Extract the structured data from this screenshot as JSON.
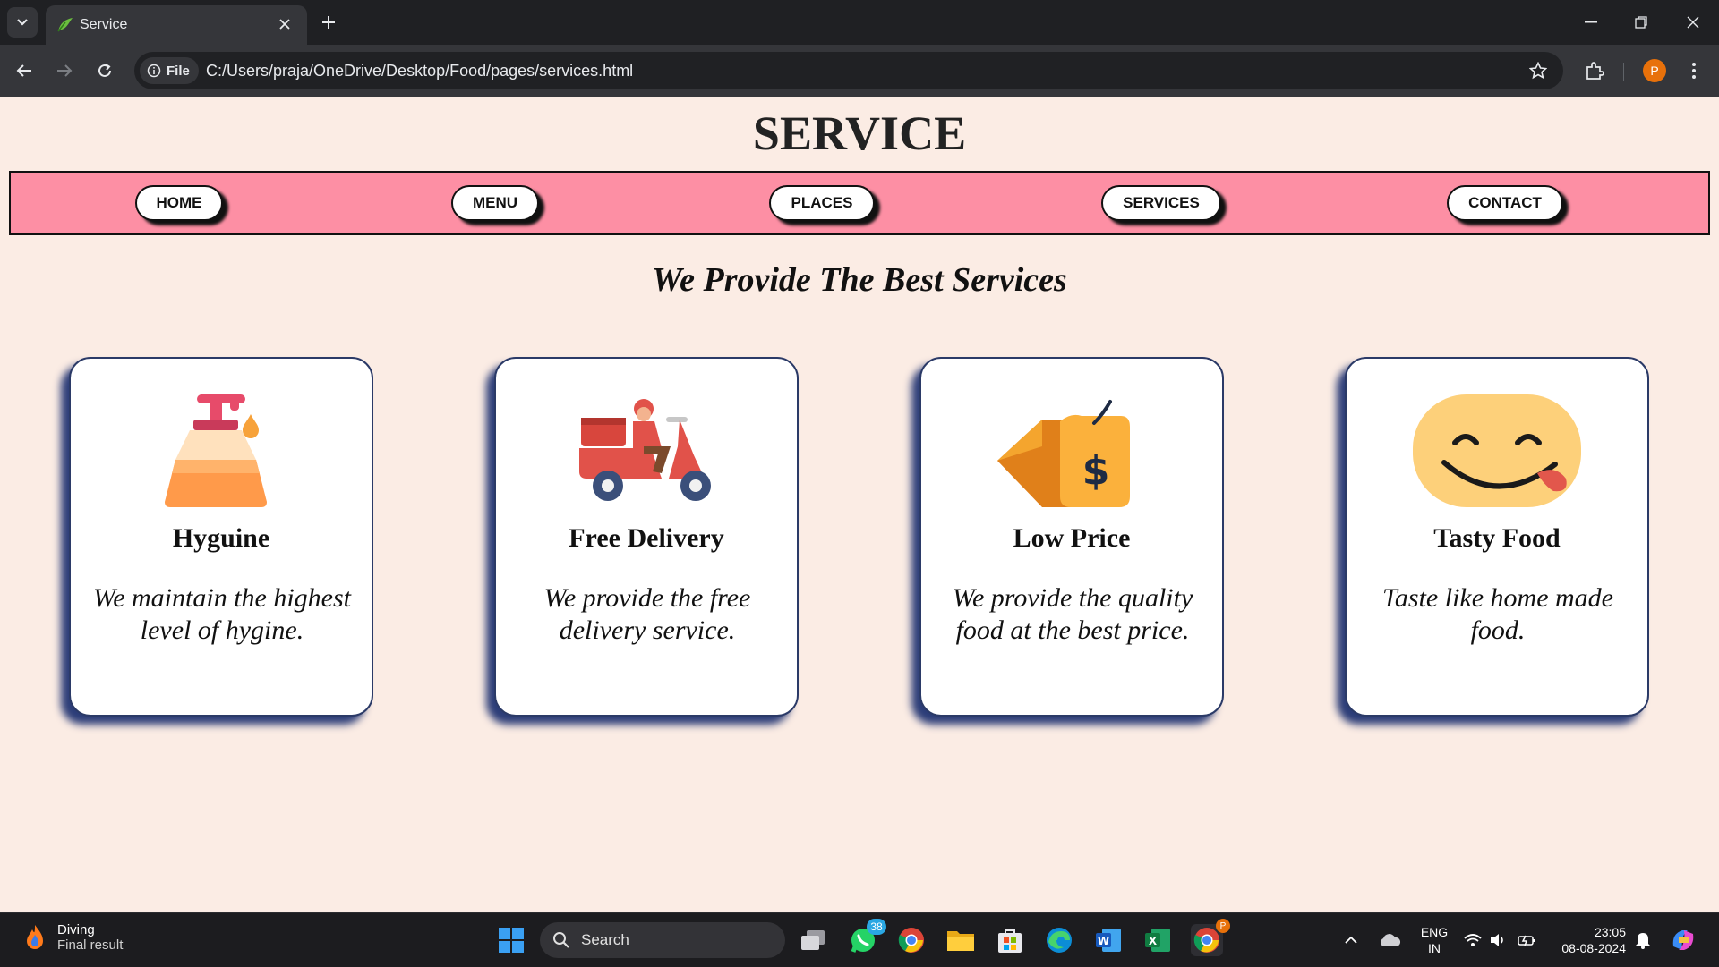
{
  "browser": {
    "tab_title": "Service",
    "address_chip": "File",
    "url": "C:/Users/praja/OneDrive/Desktop/Food/pages/services.html",
    "profile_initial": "P"
  },
  "page": {
    "title": "SERVICE",
    "nav": [
      "HOME",
      "MENU",
      "PLACES",
      "SERVICES",
      "CONTACT"
    ],
    "subtitle": "We Provide The Best Services",
    "cards": [
      {
        "icon": "soap-dispenser-icon",
        "title": "Hyguine",
        "text": "We maintain the highest level of hygine."
      },
      {
        "icon": "delivery-scooter-icon",
        "title": "Free Delivery",
        "text": "We provide the free delivery service."
      },
      {
        "icon": "price-tag-icon",
        "title": "Low Price",
        "text": "We provide the quality food at the best price."
      },
      {
        "icon": "smiley-tongue-icon",
        "title": "Tasty Food",
        "text": "Taste like home made food."
      }
    ]
  },
  "taskbar": {
    "weather_title": "Diving",
    "weather_sub": "Final result",
    "search_label": "Search",
    "whatsapp_badge": "38",
    "chrome_badge": "P",
    "lang_line1": "ENG",
    "lang_line2": "IN",
    "time": "23:05",
    "date": "08-08-2024"
  }
}
